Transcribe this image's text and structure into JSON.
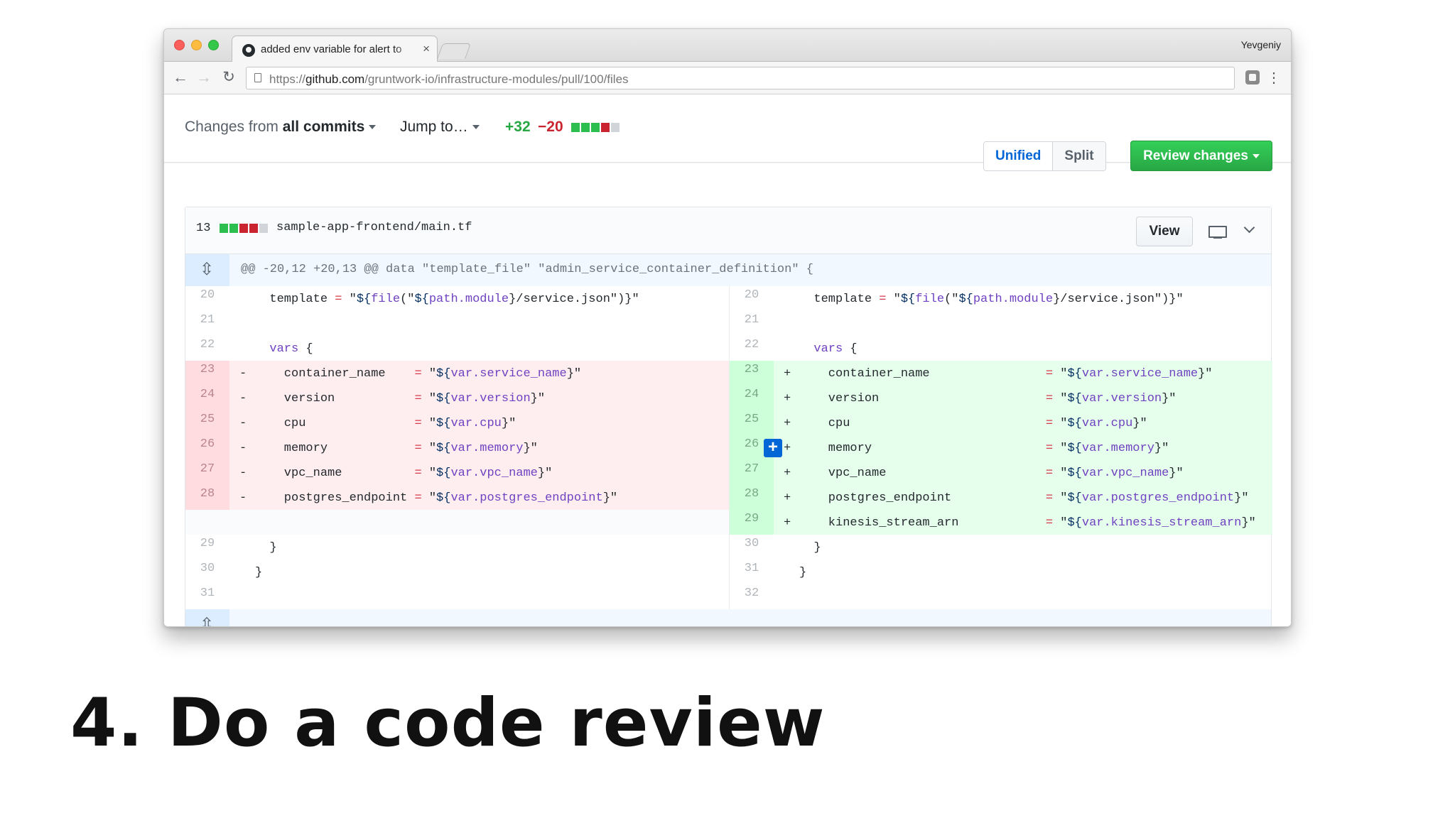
{
  "browser": {
    "tab_title": "added env variable for alert to",
    "profile": "Yevgeniy",
    "url_prefix": "https://",
    "url_host": "github.com",
    "url_path": "/gruntwork-io/infrastructure-modules/pull/100/files",
    "icons": {
      "back": "arrow-left-icon",
      "forward": "arrow-right-icon",
      "reload": "reload-icon",
      "menu": "kebab-menu-icon"
    }
  },
  "pr_toolbar": {
    "changes_prefix": "Changes from ",
    "changes_value": "all commits",
    "jump_to": "Jump to…",
    "additions": "+32",
    "deletions": "−20",
    "diffstat_blocks": [
      "add",
      "add",
      "add",
      "del",
      "neutral"
    ],
    "unified_label": "Unified",
    "split_label": "Split",
    "view_mode": "Split",
    "review_label": "Review changes",
    "colors": {
      "addition": "#28a745",
      "deletion": "#cb2431",
      "primary_button": "#2cbe4e",
      "link": "#0366d6"
    }
  },
  "file": {
    "change_count": "13",
    "diffstat_blocks": [
      "add",
      "add",
      "del",
      "del",
      "neutral"
    ],
    "name": "sample-app-frontend/main.tf",
    "view_label": "View",
    "hunk_header": "@@ -20,12 +20,13 @@ data \"template_file\" \"admin_service_container_definition\" {",
    "left_lines": [
      {
        "num": "20",
        "type": "context",
        "sign": "",
        "text": "  template = \"${file(\"${path.module}/service.json\")}\""
      },
      {
        "num": "21",
        "type": "context",
        "sign": "",
        "text": ""
      },
      {
        "num": "22",
        "type": "context",
        "sign": "",
        "text": "  vars {"
      },
      {
        "num": "23",
        "type": "del",
        "sign": "-",
        "text": "    container_name    = \"${var.service_name}\""
      },
      {
        "num": "24",
        "type": "del",
        "sign": "-",
        "text": "    version           = \"${var.version}\""
      },
      {
        "num": "25",
        "type": "del",
        "sign": "-",
        "text": "    cpu               = \"${var.cpu}\""
      },
      {
        "num": "26",
        "type": "del",
        "sign": "-",
        "text": "    memory            = \"${var.memory}\""
      },
      {
        "num": "27",
        "type": "del",
        "sign": "-",
        "text": "    vpc_name          = \"${var.vpc_name}\""
      },
      {
        "num": "28",
        "type": "del",
        "sign": "-",
        "text": "    postgres_endpoint = \"${var.postgres_endpoint}\""
      },
      {
        "num": "",
        "type": "empty",
        "sign": "",
        "text": ""
      },
      {
        "num": "29",
        "type": "context",
        "sign": "",
        "text": "  }"
      },
      {
        "num": "30",
        "type": "context",
        "sign": "",
        "text": "}"
      },
      {
        "num": "31",
        "type": "context",
        "sign": "",
        "text": ""
      }
    ],
    "right_lines": [
      {
        "num": "20",
        "type": "context",
        "sign": "",
        "text": "  template = \"${file(\"${path.module}/service.json\")}\""
      },
      {
        "num": "21",
        "type": "context",
        "sign": "",
        "text": ""
      },
      {
        "num": "22",
        "type": "context",
        "sign": "",
        "text": "  vars {"
      },
      {
        "num": "23",
        "type": "add",
        "sign": "+",
        "text": "    container_name                = \"${var.service_name}\""
      },
      {
        "num": "24",
        "type": "add",
        "sign": "+",
        "text": "    version                       = \"${var.version}\""
      },
      {
        "num": "25",
        "type": "add",
        "sign": "+",
        "text": "    cpu                           = \"${var.cpu}\""
      },
      {
        "num": "26",
        "type": "add",
        "sign": "+",
        "text": "    memory                        = \"${var.memory}\""
      },
      {
        "num": "27",
        "type": "add",
        "sign": "+",
        "text": "    vpc_name                      = \"${var.vpc_name}\""
      },
      {
        "num": "28",
        "type": "add",
        "sign": "+",
        "text": "    postgres_endpoint             = \"${var.postgres_endpoint}\""
      },
      {
        "num": "29",
        "type": "add",
        "sign": "+",
        "text": "    kinesis_stream_arn            = \"${var.kinesis_stream_arn}\""
      },
      {
        "num": "30",
        "type": "context",
        "sign": "",
        "text": "  }"
      },
      {
        "num": "31",
        "type": "context",
        "sign": "",
        "text": "}"
      },
      {
        "num": "32",
        "type": "context",
        "sign": "",
        "text": ""
      }
    ],
    "comment_button_line": "26"
  },
  "caption": "4. Do a code review"
}
